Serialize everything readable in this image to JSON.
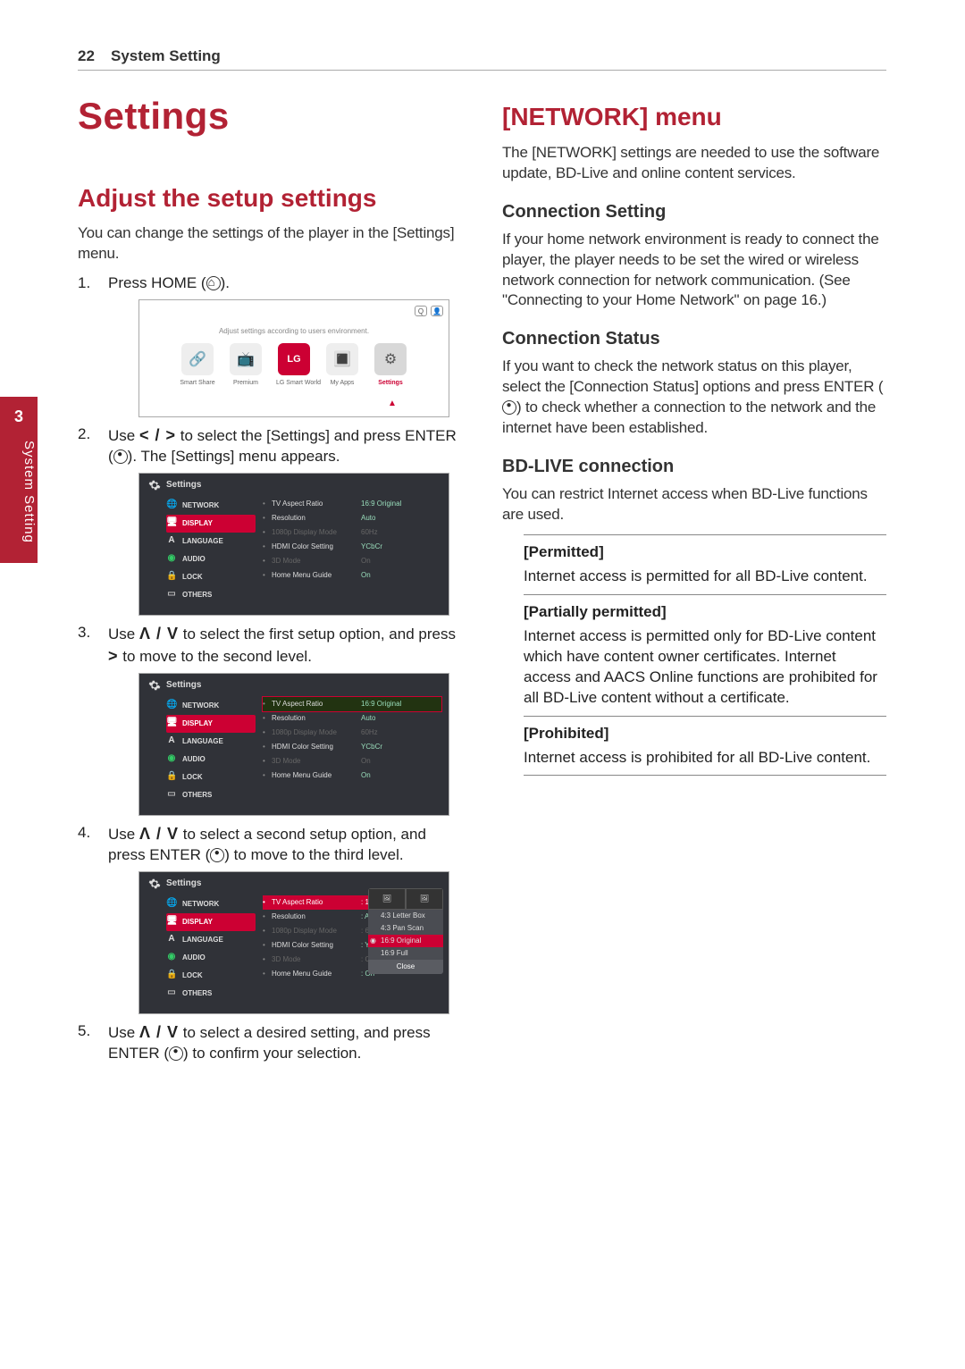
{
  "page": {
    "number": "22",
    "header": "System Setting"
  },
  "spine": {
    "chapter": "3",
    "label": "System Setting"
  },
  "left": {
    "title": "Settings",
    "section": "Adjust the setup settings",
    "intro": "You can change the settings of the player in the [Settings] menu.",
    "steps": {
      "s1_num": "1.",
      "s1_pre": "Press HOME (",
      "s1_post": ").",
      "s2_num": "2.",
      "s2_text": "to select the [Settings] and press ENTER (",
      "s2_pre": "Use",
      "s2_nav": "< / >",
      "s2_post": "). The [Settings] menu appears.",
      "s3_num": "3.",
      "s3_pre": "Use",
      "s3_nav": "Λ / V",
      "s3_text": "to select the first setup option, and press",
      "s3_nav2": ">",
      "s3_post": "to move to the second level.",
      "s4_num": "4.",
      "s4_pre": "Use",
      "s4_nav": "Λ / V",
      "s4_text": "to select a second setup option, and press ENTER (",
      "s4_post": ") to move to the third level.",
      "s5_num": "5.",
      "s5_pre": "Use",
      "s5_nav": "Λ / V",
      "s5_text": "to select a desired setting, and press ENTER (",
      "s5_post": ") to confirm your selection."
    }
  },
  "right": {
    "network_title": "[NETWORK] menu",
    "network_intro": "The [NETWORK] settings are needed to use the software update, BD-Live and online content services.",
    "conn_setting_h": "Connection Setting",
    "conn_setting_p": "If your home network environment is ready to connect the player, the player needs to be set the wired or wireless network connection for network communication. (See \"Connecting to your Home Network\" on page 16.)",
    "conn_status_h": "Connection Status",
    "conn_status_p": "If you want to check the network status on this player, select the [Connection Status] options and press ENTER (   ) to check whether a connection to the network and the internet have been established.",
    "bdlive_h": "BD-LIVE connection",
    "bdlive_p": "You can restrict Internet access when BD-Live functions are used.",
    "bd": {
      "permitted_label": "[Permitted]",
      "permitted_text": "Internet access is permitted for all BD-Live content.",
      "partial_label": "[Partially permitted]",
      "partial_text": "Internet access is permitted only for BD-Live content which have content owner certificates. Internet access and AACS Online functions are prohibited for all BD-Live content without a certificate.",
      "prohibited_label": "[Prohibited]",
      "prohibited_text": "Internet access is prohibited for all BD-Live content."
    }
  },
  "shot_home": {
    "caption": "Adjust settings according to users environment.",
    "icons": [
      "Smart Share",
      "Premium",
      "LG Smart World",
      "My Apps",
      "Settings"
    ],
    "search": "Q",
    "login": "👤"
  },
  "shot_settings": {
    "title": "Settings",
    "sidebar": [
      "NETWORK",
      "DISPLAY",
      "LANGUAGE",
      "AUDIO",
      "LOCK",
      "OTHERS"
    ],
    "rows": [
      {
        "k": "TV Aspect Ratio",
        "v": "16:9 Original"
      },
      {
        "k": "Resolution",
        "v": "Auto"
      },
      {
        "k": "1080p Display Mode",
        "v": "60Hz",
        "dim": true
      },
      {
        "k": "HDMI Color Setting",
        "v": "YCbCr"
      },
      {
        "k": "3D Mode",
        "v": "On",
        "dim": true
      },
      {
        "k": "Home Menu Guide",
        "v": "On"
      }
    ],
    "popup": {
      "options": [
        "4:3 Letter Box",
        "4:3 Pan Scan",
        "16:9 Original",
        "16:9 Full"
      ],
      "selected": "16:9 Original",
      "close": "Close"
    }
  }
}
